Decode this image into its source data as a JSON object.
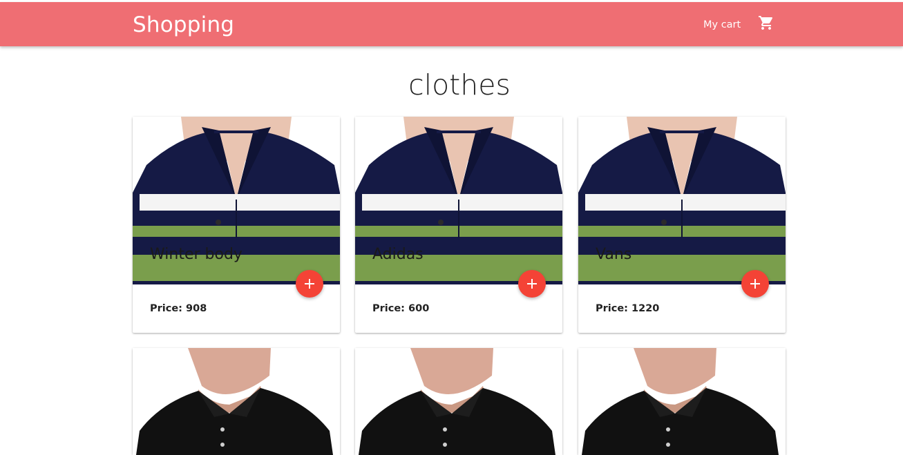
{
  "navbar": {
    "brand": "Shopping",
    "cart_label": "My cart",
    "cart_icon": "shopping-cart-icon",
    "bg_color": "#ef6e73"
  },
  "page": {
    "title": "clothes"
  },
  "products": [
    {
      "name": "Winter body",
      "price_text": "Price: 908",
      "image": "striped-polo-shirt",
      "add_icon": "plus-icon"
    },
    {
      "name": "Adidas",
      "price_text": "Price: 600",
      "image": "striped-polo-shirt",
      "add_icon": "plus-icon"
    },
    {
      "name": "Vans",
      "price_text": "Price: 1220",
      "image": "striped-polo-shirt",
      "add_icon": "plus-icon"
    },
    {
      "image": "black-polo-shirt"
    },
    {
      "image": "black-polo-shirt"
    },
    {
      "image": "black-polo-shirt"
    }
  ],
  "colors": {
    "accent": "#f44336"
  }
}
